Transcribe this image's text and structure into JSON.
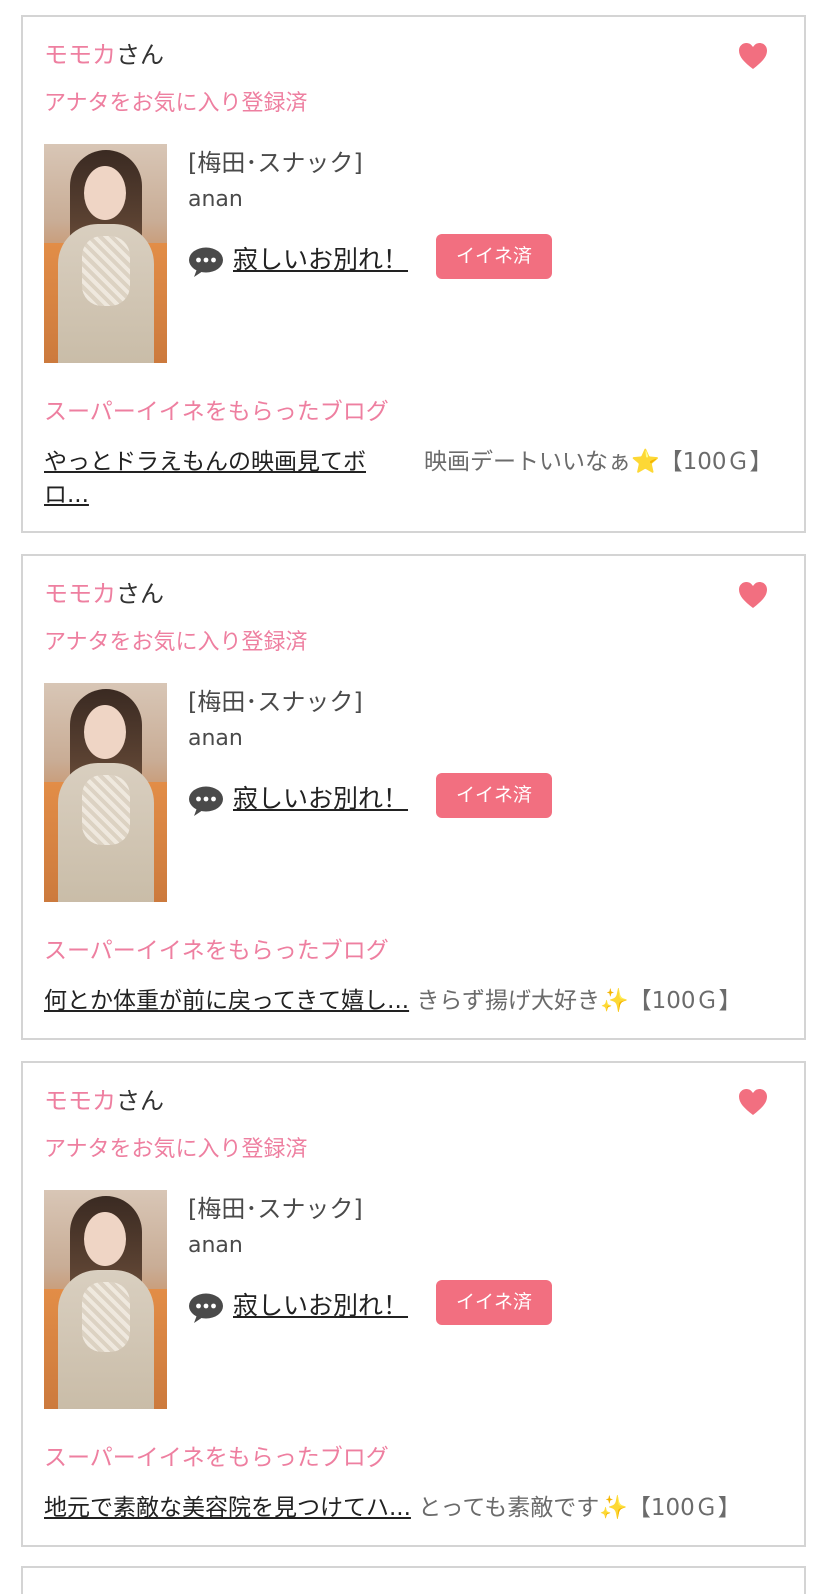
{
  "colors": {
    "accent_pink": "#ee7fa0",
    "like_badge": "#f26f80",
    "border": "#d4d4d4"
  },
  "cards": [
    {
      "name": "モモカ",
      "honorific": "さん",
      "fav_status": "アナタをお気に入り登録済",
      "shop": "[梅田･スナック]",
      "shop_name": "anan",
      "post_title": "寂しいお別れ！",
      "like_label": "イイネ済",
      "blog_heading": "スーパーイイネをもらったブログ",
      "blog_title": "やっとドラえもんの映画見てボロ...",
      "blog_comment": "映画デートいいなぁ⭐️【100Ｇ】"
    },
    {
      "name": "モモカ",
      "honorific": "さん",
      "fav_status": "アナタをお気に入り登録済",
      "shop": "[梅田･スナック]",
      "shop_name": "anan",
      "post_title": "寂しいお別れ！",
      "like_label": "イイネ済",
      "blog_heading": "スーパーイイネをもらったブログ",
      "blog_title": "何とか体重が前に戻ってきて嬉し...",
      "blog_comment": "きらず揚げ大好き✨【100Ｇ】"
    },
    {
      "name": "モモカ",
      "honorific": "さん",
      "fav_status": "アナタをお気に入り登録済",
      "shop": "[梅田･スナック]",
      "shop_name": "anan",
      "post_title": "寂しいお別れ！",
      "like_label": "イイネ済",
      "blog_heading": "スーパーイイネをもらったブログ",
      "blog_title": "地元で素敵な美容院を見つけてハ...",
      "blog_comment": "とっても素敵です✨【100Ｇ】"
    }
  ],
  "icons": {
    "favorite": "heart-icon",
    "post": "chat-bubble-icon"
  }
}
